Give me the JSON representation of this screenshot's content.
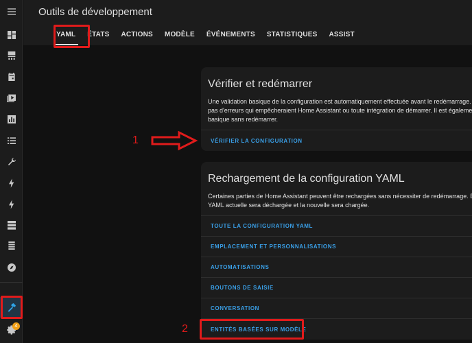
{
  "header": {
    "title": "Outils de développement",
    "tabs": [
      {
        "label": "YAML",
        "active": true
      },
      {
        "label": "ÉTATS"
      },
      {
        "label": "ACTIONS"
      },
      {
        "label": "MODÈLE"
      },
      {
        "label": "ÉVÉNEMENTS"
      },
      {
        "label": "STATISTIQUES"
      },
      {
        "label": "ASSIST"
      }
    ]
  },
  "sidebar": {
    "items": [
      {
        "icon": "menu-icon"
      },
      {
        "icon": "dashboard-icon"
      },
      {
        "icon": "energy-icon"
      },
      {
        "icon": "calendar-icon"
      },
      {
        "icon": "media-icon"
      },
      {
        "icon": "history-icon"
      },
      {
        "icon": "list-icon"
      },
      {
        "icon": "wrench-icon"
      },
      {
        "icon": "lightning-icon"
      },
      {
        "icon": "lightning-icon-2"
      },
      {
        "icon": "server-icon"
      },
      {
        "icon": "database-icon"
      },
      {
        "icon": "compass-icon"
      },
      {
        "icon": "hammer-icon",
        "active": true
      },
      {
        "icon": "gear-icon",
        "badge": "4"
      }
    ]
  },
  "card_check": {
    "title": "Vérifier et redémarrer",
    "text_lines": [
      "Une validation basique de la configuration est automatiquement effectuée avant le redémarrage. Il",
      "pas d'erreurs qui empêcheraient Home Assistant ou toute intégration de démarrer. Il est égalemen",
      "basique sans redémarrer."
    ],
    "action": "VÉRIFIER LA CONFIGURATION"
  },
  "card_reload": {
    "title": "Rechargement de la configuration YAML",
    "text_lines": [
      "Certaines parties de Home Assistant peuvent être rechargées sans nécessiter de redémarrage. En",
      "YAML actuelle sera déchargée et la nouvelle sera chargée."
    ],
    "actions": [
      "TOUTE LA CONFIGURATION YAML",
      "EMPLACEMENT ET PERSONNALISATIONS",
      "AUTOMATISATIONS",
      "BOUTONS DE SAISIE",
      "CONVERSATION",
      "ENTITÉS BASÉES SUR MODÈLE"
    ]
  },
  "annotations": {
    "one": "1",
    "two": "2"
  },
  "colors": {
    "accent": "#3aa0e8",
    "highlight": "#e01b1b",
    "badge": "#f2a018"
  }
}
